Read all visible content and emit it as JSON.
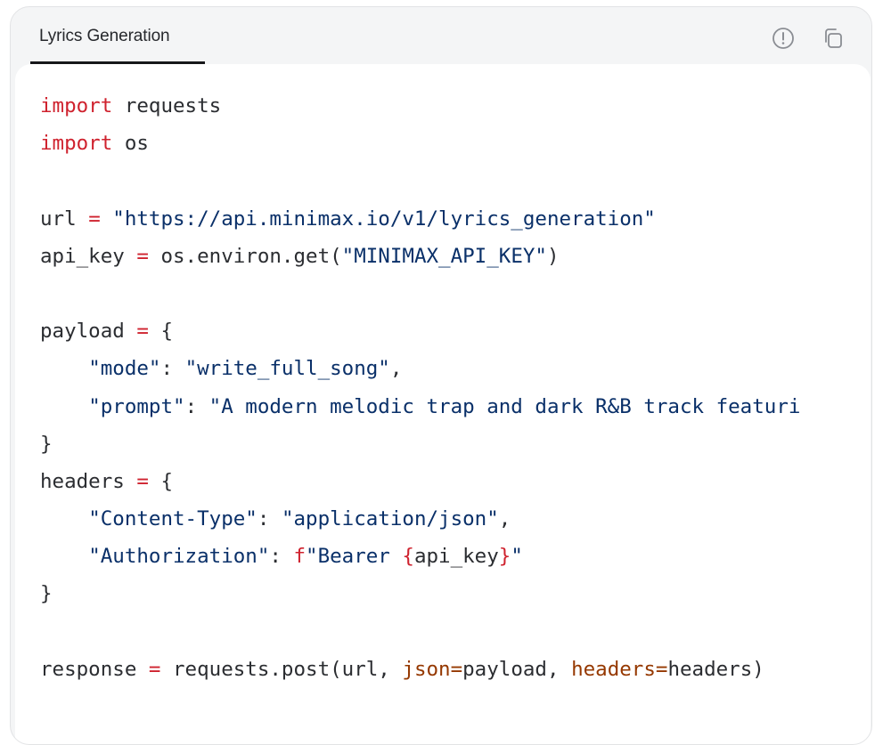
{
  "tab": {
    "label": "Lyrics Generation"
  },
  "actions": [
    {
      "name": "info-icon",
      "purpose": "info"
    },
    {
      "name": "copy-icon",
      "purpose": "copy"
    }
  ],
  "code": {
    "language": "python",
    "lines": [
      [
        {
          "t": "import",
          "k": "kw"
        },
        {
          "t": " requests",
          "k": "txt"
        }
      ],
      [
        {
          "t": "import",
          "k": "kw"
        },
        {
          "t": " os",
          "k": "txt"
        }
      ],
      [],
      [
        {
          "t": "url ",
          "k": "txt"
        },
        {
          "t": "=",
          "k": "op"
        },
        {
          "t": " ",
          "k": "txt"
        },
        {
          "t": "\"https://api.minimax.io/v1/lyrics_generation\"",
          "k": "str"
        }
      ],
      [
        {
          "t": "api_key ",
          "k": "txt"
        },
        {
          "t": "=",
          "k": "op"
        },
        {
          "t": " os.environ.get(",
          "k": "txt"
        },
        {
          "t": "\"MINIMAX_API_KEY\"",
          "k": "str"
        },
        {
          "t": ")",
          "k": "txt"
        }
      ],
      [],
      [
        {
          "t": "payload ",
          "k": "txt"
        },
        {
          "t": "=",
          "k": "op"
        },
        {
          "t": " {",
          "k": "txt"
        }
      ],
      [
        {
          "t": "    ",
          "k": "txt"
        },
        {
          "t": "\"mode\"",
          "k": "str"
        },
        {
          "t": ": ",
          "k": "txt"
        },
        {
          "t": "\"write_full_song\"",
          "k": "str"
        },
        {
          "t": ",",
          "k": "txt"
        }
      ],
      [
        {
          "t": "    ",
          "k": "txt"
        },
        {
          "t": "\"prompt\"",
          "k": "str"
        },
        {
          "t": ": ",
          "k": "txt"
        },
        {
          "t": "\"A modern melodic trap and dark R&B track featuri",
          "k": "str"
        }
      ],
      [
        {
          "t": "}",
          "k": "txt"
        }
      ],
      [
        {
          "t": "headers ",
          "k": "txt"
        },
        {
          "t": "=",
          "k": "op"
        },
        {
          "t": " {",
          "k": "txt"
        }
      ],
      [
        {
          "t": "    ",
          "k": "txt"
        },
        {
          "t": "\"Content-Type\"",
          "k": "str"
        },
        {
          "t": ": ",
          "k": "txt"
        },
        {
          "t": "\"application/json\"",
          "k": "str"
        },
        {
          "t": ",",
          "k": "txt"
        }
      ],
      [
        {
          "t": "    ",
          "k": "txt"
        },
        {
          "t": "\"Authorization\"",
          "k": "str"
        },
        {
          "t": ": ",
          "k": "txt"
        },
        {
          "t": "f",
          "k": "kw"
        },
        {
          "t": "\"Bearer ",
          "k": "str"
        },
        {
          "t": "{",
          "k": "op"
        },
        {
          "t": "api_key",
          "k": "txt"
        },
        {
          "t": "}",
          "k": "op"
        },
        {
          "t": "\"",
          "k": "str"
        }
      ],
      [
        {
          "t": "}",
          "k": "txt"
        }
      ],
      [],
      [
        {
          "t": "response ",
          "k": "txt"
        },
        {
          "t": "=",
          "k": "op"
        },
        {
          "t": " requests.post(url, ",
          "k": "txt"
        },
        {
          "t": "json=",
          "k": "par"
        },
        {
          "t": "payload, ",
          "k": "txt"
        },
        {
          "t": "headers=",
          "k": "par"
        },
        {
          "t": "headers)",
          "k": "txt"
        }
      ]
    ]
  },
  "colors": {
    "keyword": "#cf222e",
    "string": "#0a3069",
    "parameter": "#953800",
    "text": "#2b2d31",
    "panel": "#ffffff",
    "card": "#f4f5f6"
  }
}
